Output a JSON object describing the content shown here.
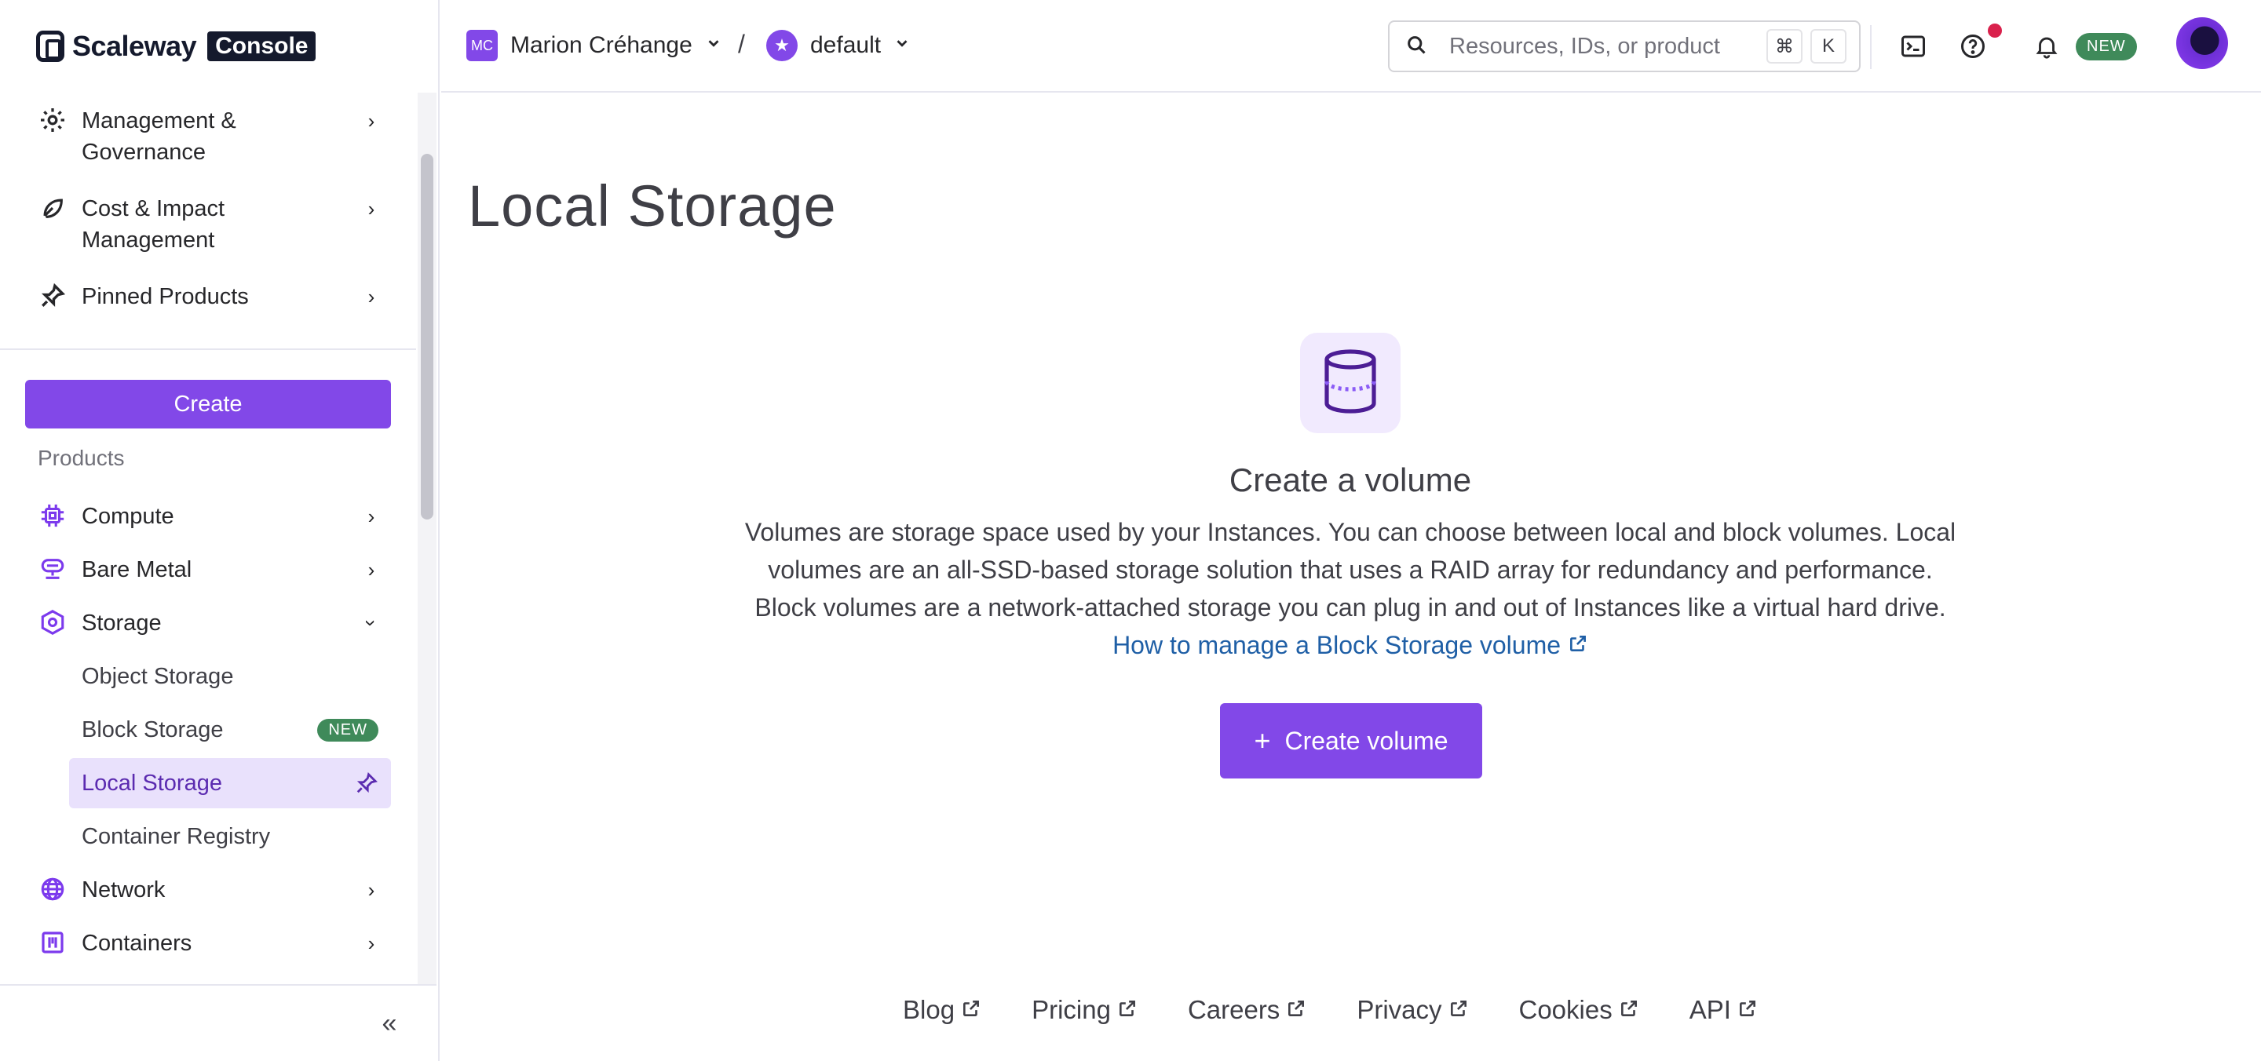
{
  "brand": {
    "name": "Scaleway",
    "badge": "Console"
  },
  "sidebar": {
    "top_items": [
      {
        "label": "Management & Governance",
        "icon": "gear-icon"
      },
      {
        "label": "Cost & Impact Management",
        "icon": "leaf-icon"
      },
      {
        "label": "Pinned Products",
        "icon": "pin-icon"
      }
    ],
    "create_label": "Create",
    "products_heading": "Products",
    "products": [
      {
        "label": "Compute",
        "icon": "chip-icon",
        "state": "collapsed"
      },
      {
        "label": "Bare Metal",
        "icon": "server-icon",
        "state": "collapsed"
      },
      {
        "label": "Storage",
        "icon": "hexagon-icon",
        "state": "expanded"
      }
    ],
    "storage_children": [
      {
        "label": "Object Storage"
      },
      {
        "label": "Block Storage",
        "badge": "NEW"
      },
      {
        "label": "Local Storage",
        "active": true
      },
      {
        "label": "Container Registry"
      }
    ],
    "more_products": [
      {
        "label": "Network",
        "icon": "globe-icon"
      },
      {
        "label": "Containers",
        "icon": "container-icon"
      }
    ],
    "collapse_icon": "double-chevron-left-icon"
  },
  "topbar": {
    "org_initials": "MC",
    "org_name": "Marion Créhange",
    "separator": "/",
    "project_name": "default",
    "search_placeholder": "Resources, IDs, or product",
    "shortcut_keys": [
      "⌘",
      "K"
    ],
    "new_label": "NEW"
  },
  "main": {
    "title": "Local Storage",
    "empty_state": {
      "title": "Create a volume",
      "description": "Volumes are storage space used by your Instances. You can choose between local and block volumes. Local volumes are an all-SSD-based storage solution that uses a RAID array for redundancy and performance. Block volumes are a network-attached storage you can plug in and out of Instances like a virtual hard drive.",
      "link_label": "How to manage a Block Storage volume",
      "button_label": "Create volume"
    }
  },
  "footer": {
    "links": [
      "Blog",
      "Pricing",
      "Careers",
      "Privacy",
      "Cookies",
      "API"
    ]
  },
  "colors": {
    "accent": "#8248e8",
    "accent_light": "#e9e1fc",
    "badge_green": "#3f8a5a",
    "link_blue": "#1f5fa6",
    "notification_red": "#d9214c"
  }
}
